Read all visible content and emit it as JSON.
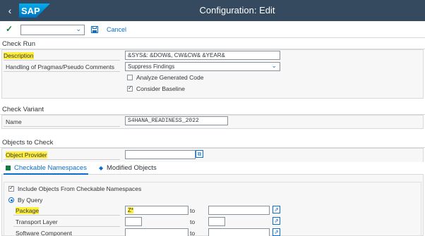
{
  "header": {
    "title": "Configuration: Edit",
    "logo_text": "SAP"
  },
  "toolbar": {
    "cancel_label": "Cancel",
    "variant_value": ""
  },
  "check_run": {
    "section_title": "Check Run",
    "description_label": "Description",
    "description_value": "&SYS&: &DOW&, CW&CW& &YEAR&",
    "pragmas_label": "Handling of Pragmas/Pseudo Comments",
    "pragmas_value": "Suppress Findings",
    "analyze_label": "Analyze Generated Code",
    "analyze_checked": false,
    "baseline_label": "Consider Baseline",
    "baseline_checked": true
  },
  "check_variant": {
    "section_title": "Check Variant",
    "name_label": "Name",
    "name_value": "S4HANA_READINESS_2022"
  },
  "objects": {
    "section_title": "Objects to Check",
    "provider_label": "Object Provider",
    "provider_value": "",
    "tabs": [
      {
        "label": "Checkable Namespaces",
        "active": true
      },
      {
        "label": "Modified Objects",
        "active": false
      }
    ],
    "include_label": "Include Objects From Checkable Namespaces",
    "by_query_label": "By Query",
    "rows": [
      {
        "label": "Package",
        "from": "Z*",
        "to_label": "to",
        "to": ""
      },
      {
        "label": "Transport Layer",
        "from": "",
        "to_label": "to",
        "to": ""
      },
      {
        "label": "Software Component",
        "from": "",
        "to_label": "to",
        "to": ""
      }
    ]
  },
  "colors": {
    "shell": "#354a5f",
    "accent": "#0a6ed1",
    "highlight": "#ffef3b",
    "ok": "#107e3e"
  }
}
